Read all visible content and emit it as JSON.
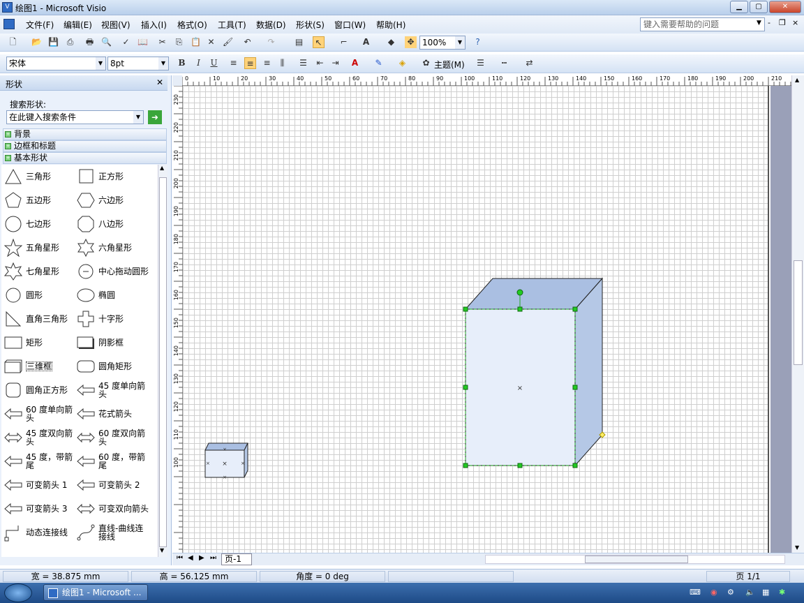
{
  "window": {
    "title": "绘图1 - Microsoft Visio",
    "min": "▁",
    "max": "▢",
    "close": "✕"
  },
  "menu": [
    "文件(F)",
    "编辑(E)",
    "视图(V)",
    "插入(I)",
    "格式(O)",
    "工具(T)",
    "数据(D)",
    "形状(S)",
    "窗口(W)",
    "帮助(H)"
  ],
  "help_placeholder": "键入需要帮助的问题",
  "toolbar": {
    "zoom": "100%"
  },
  "format_toolbar": {
    "font": "宋体",
    "size": "8pt",
    "bold": "B",
    "italic": "I",
    "underline": "U",
    "theme": "主题(M)"
  },
  "shapes_pane": {
    "title": "形状",
    "search_label": "搜索形状:",
    "search_placeholder": "在此键入搜索条件",
    "categories": [
      "背景",
      "边框和标题",
      "基本形状"
    ],
    "items": [
      {
        "l1": "三角形",
        "icon": "triangle-icon"
      },
      {
        "l1": "正方形",
        "icon": "square-icon"
      },
      {
        "l1": "五边形",
        "icon": "pentagon-icon"
      },
      {
        "l1": "六边形",
        "icon": "hexagon-icon"
      },
      {
        "l1": "七边形",
        "icon": "heptagon-icon"
      },
      {
        "l1": "八边形",
        "icon": "octagon-icon"
      },
      {
        "l1": "五角星形",
        "icon": "star5-icon"
      },
      {
        "l1": "六角星形",
        "icon": "star6-icon"
      },
      {
        "l1": "七角星形",
        "icon": "star7-icon"
      },
      {
        "l1": "中心拖动圆形",
        "icon": "center-circle-icon"
      },
      {
        "l1": "圆形",
        "icon": "circle-icon"
      },
      {
        "l1": "椭圆",
        "icon": "ellipse-icon"
      },
      {
        "l1": "直角三角形",
        "icon": "right-triangle-icon"
      },
      {
        "l1": "十字形",
        "icon": "cross-icon"
      },
      {
        "l1": "矩形",
        "icon": "rectangle-icon"
      },
      {
        "l1": "阴影框",
        "icon": "shadow-box-icon"
      },
      {
        "l1": "三维框",
        "icon": "3d-box-icon"
      },
      {
        "l1": "圆角矩形",
        "icon": "rounded-rect-icon"
      },
      {
        "l1": "圆角正方形",
        "icon": "rounded-square-icon"
      },
      {
        "l1": "45 度单向箭",
        "l2": "头",
        "icon": "arrow45-icon"
      },
      {
        "l1": "60 度单向箭",
        "l2": "头",
        "icon": "arrow60-icon"
      },
      {
        "l1": "花式箭头",
        "icon": "fancy-arrow-icon"
      },
      {
        "l1": "45 度双向箭",
        "l2": "头",
        "icon": "double-arrow45-icon"
      },
      {
        "l1": "60 度双向箭",
        "l2": "头",
        "icon": "double-arrow60-icon"
      },
      {
        "l1": "45 度，带箭",
        "l2": "尾",
        "icon": "tail-arrow45-icon"
      },
      {
        "l1": "60 度，带箭",
        "l2": "尾",
        "icon": "tail-arrow60-icon"
      },
      {
        "l1": "可变箭头 1",
        "icon": "variable-arrow1-icon"
      },
      {
        "l1": "可变箭头 2",
        "icon": "variable-arrow2-icon"
      },
      {
        "l1": "可变箭头 3",
        "icon": "variable-arrow3-icon"
      },
      {
        "l1": "可变双向箭头",
        "icon": "variable-double-arrow-icon"
      },
      {
        "l1": "动态连接线",
        "icon": "dynamic-connector-icon"
      },
      {
        "l1": "直线-曲线连",
        "l2": "接线",
        "icon": "line-curve-connector-icon"
      }
    ]
  },
  "ruler": {
    "h": [
      "0",
      "10",
      "20",
      "30",
      "40",
      "50",
      "60",
      "70",
      "80",
      "90",
      "100",
      "110",
      "120",
      "130",
      "140",
      "150",
      "160",
      "170",
      "180",
      "190",
      "200",
      "210"
    ],
    "v": [
      "230",
      "220",
      "210",
      "200",
      "190",
      "180",
      "170",
      "160",
      "150",
      "140",
      "130",
      "120",
      "110",
      "100"
    ]
  },
  "page_tab": "页-1",
  "status": {
    "width": "宽 = 38.875 mm",
    "height": "高 = 56.125 mm",
    "angle": "角度 = 0 deg",
    "page": "页 1/1"
  },
  "taskbar": {
    "task": "绘图1 - Microsoft ..."
  },
  "colors": {
    "box_front": "#e7eefa",
    "box_side": "#b5c8e6",
    "box_top": "#aabfe2",
    "handle": "#22cc22"
  }
}
